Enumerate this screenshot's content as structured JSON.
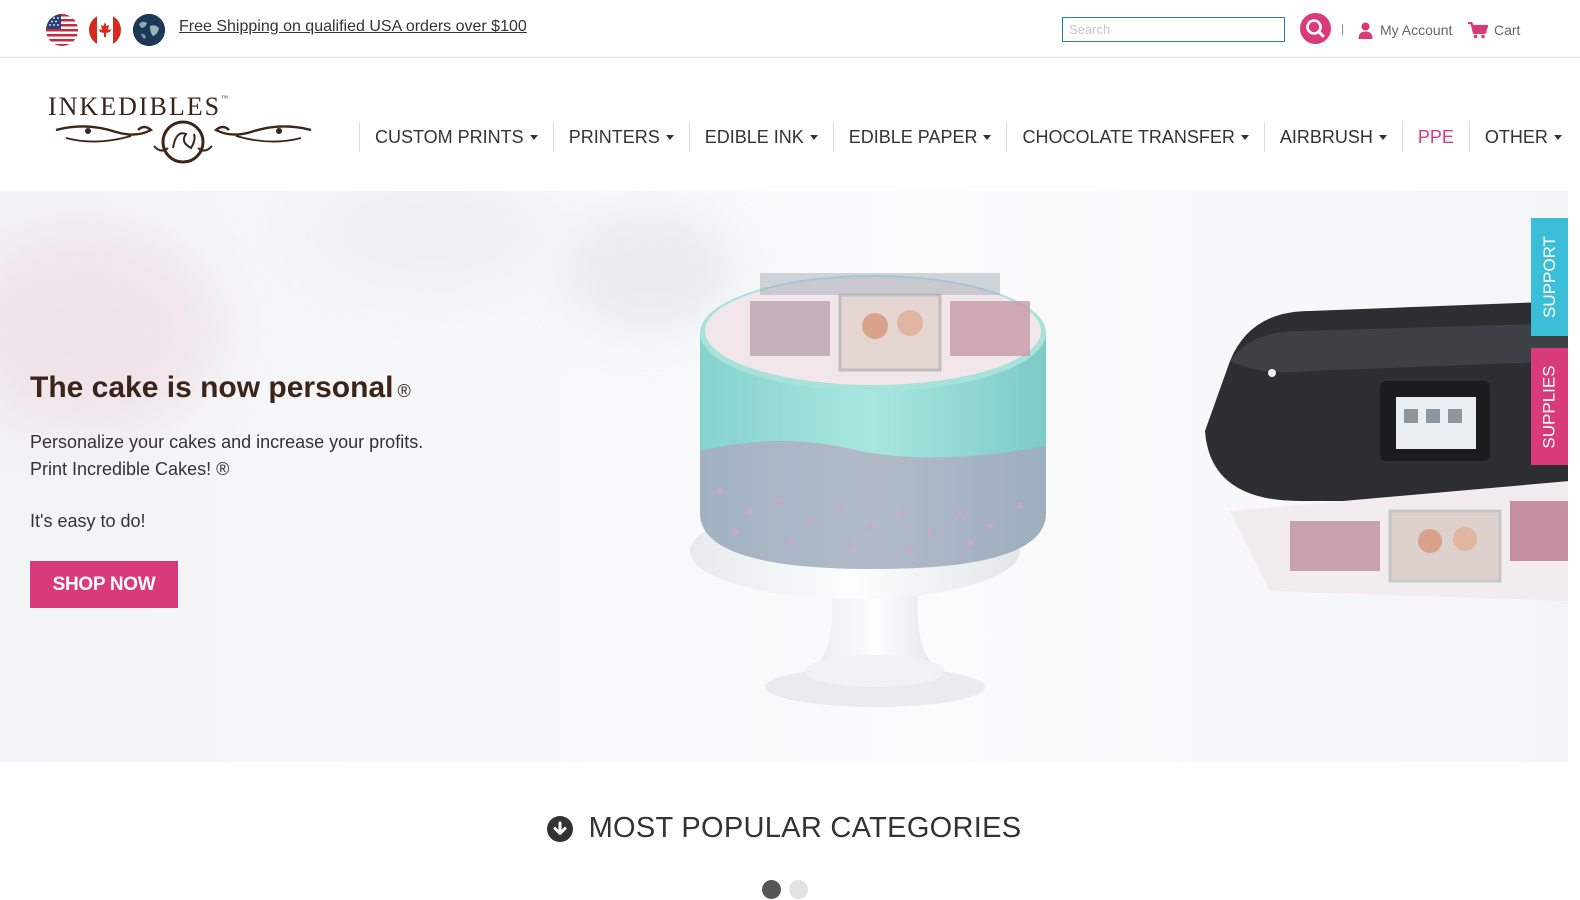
{
  "topbar": {
    "flags": [
      "us-flag-icon",
      "canada-flag-icon",
      "globe-icon"
    ],
    "shipping_text": "Free Shipping on qualified USA orders over $100",
    "search_placeholder": "Search",
    "separator": "|",
    "account_label": "My Account",
    "cart_label": "Cart"
  },
  "brand": {
    "name": "INKEDIBLES",
    "tm": "™"
  },
  "nav": {
    "items": [
      {
        "label": "CUSTOM PRINTS",
        "dropdown": true
      },
      {
        "label": "PRINTERS",
        "dropdown": true
      },
      {
        "label": "EDIBLE INK",
        "dropdown": true
      },
      {
        "label": "EDIBLE PAPER",
        "dropdown": true
      },
      {
        "label": "CHOCOLATE TRANSFER",
        "dropdown": true
      },
      {
        "label": "AIRBRUSH",
        "dropdown": true
      },
      {
        "label": "PPE",
        "dropdown": false
      },
      {
        "label": "OTHER",
        "dropdown": true
      }
    ]
  },
  "hero": {
    "title": "The cake is now personal",
    "title_mark": "®",
    "line1": "Personalize your cakes and increase your profits.",
    "line2": "Print Incredible Cakes! ®",
    "line3": "It's easy to do!",
    "cta": "SHOP NOW"
  },
  "side_tabs": {
    "support": "SUPPORT",
    "supplies": "SUPPLIES"
  },
  "categories": {
    "heading": "MOST POPULAR CATEGORIES",
    "icon": "arrow-circle-down-icon"
  },
  "carousel": {
    "slide_count": 2,
    "active": 1
  },
  "colors": {
    "accent": "#d93a7a",
    "support_tab": "#3bbfd9",
    "brand_brown": "#3b2418",
    "link_blue": "#2a7ab8"
  }
}
